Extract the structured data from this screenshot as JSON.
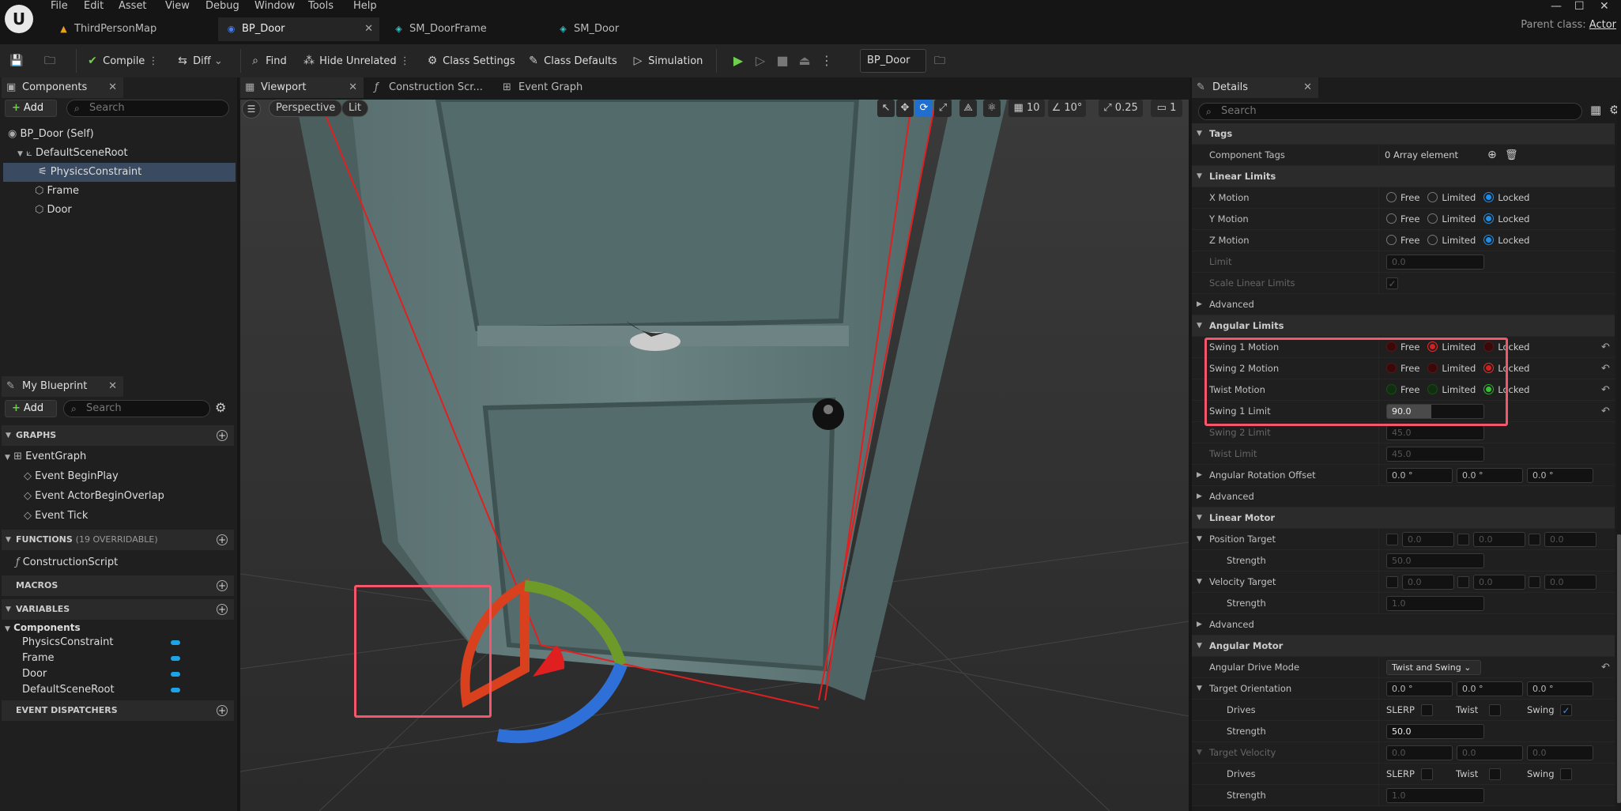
{
  "app": {
    "logo": "U",
    "menu": [
      "File",
      "Edit",
      "Asset",
      "View",
      "Debug",
      "Window",
      "Tools",
      "Help"
    ],
    "tabs": [
      {
        "label": "ThirdPersonMap",
        "icon": "map-icon"
      },
      {
        "label": "BP_Door",
        "icon": "blueprint-icon"
      },
      {
        "label": "SM_DoorFrame",
        "icon": "static-mesh-icon"
      },
      {
        "label": "SM_Door",
        "icon": "static-mesh-icon"
      }
    ],
    "parent_class_label": "Parent class:",
    "parent_class_value": "Actor"
  },
  "toolbar": {
    "compile": "Compile",
    "diff": "Diff",
    "find": "Find",
    "hide_unrelated": "Hide Unrelated",
    "class_settings": "Class Settings",
    "class_defaults": "Class Defaults",
    "simulation": "Simulation",
    "debug_object": "BP_Door"
  },
  "components": {
    "tab": "Components",
    "add": "Add",
    "search_placeholder": "Search",
    "tree": [
      "BP_Door (Self)",
      "DefaultSceneRoot",
      "PhysicsConstraint",
      "Frame",
      "Door"
    ]
  },
  "my_blueprint": {
    "tab": "My Blueprint",
    "add": "Add",
    "search_placeholder": "Search",
    "graphs_header": "GRAPHS",
    "event_graph": "EventGraph",
    "events": [
      "Event BeginPlay",
      "Event ActorBeginOverlap",
      "Event Tick"
    ],
    "functions_header": "FUNCTIONS",
    "functions_count": "(19 OVERRIDABLE)",
    "construction_script": "ConstructionScript",
    "macros_header": "MACROS",
    "variables_header": "VARIABLES",
    "components_group": "Components",
    "variables": [
      "PhysicsConstraint",
      "Frame",
      "Door",
      "DefaultSceneRoot"
    ],
    "event_dispatchers_header": "EVENT DISPATCHERS"
  },
  "editor_tabs": [
    "Viewport",
    "Construction Scr...",
    "Event Graph"
  ],
  "viewport": {
    "perspective": "Perspective",
    "lit": "Lit",
    "grid_snap": "10",
    "rot_snap": "10°",
    "scale_snap": "0.25",
    "camera_speed": "1"
  },
  "details": {
    "tab": "Details",
    "search_placeholder": "Search",
    "tags_header": "Tags",
    "component_tags": "Component Tags",
    "component_tags_value": "0 Array element",
    "linear_limits_header": "Linear Limits",
    "x_motion": "X Motion",
    "y_motion": "Y Motion",
    "z_motion": "Z Motion",
    "motion_options": [
      "Free",
      "Limited",
      "Locked"
    ],
    "limit": "Limit",
    "limit_value": "0.0",
    "scale_linear_limits": "Scale Linear Limits",
    "advanced": "Advanced",
    "angular_limits_header": "Angular Limits",
    "swing1_motion": "Swing 1 Motion",
    "swing2_motion": "Swing 2 Motion",
    "twist_motion": "Twist Motion",
    "swing1_limit": "Swing 1 Limit",
    "swing1_limit_value": "90.0",
    "swing2_limit": "Swing 2 Limit",
    "swing2_limit_value": "45.0",
    "twist_limit": "Twist Limit",
    "twist_limit_value": "45.0",
    "angular_rotation_offset": "Angular Rotation Offset",
    "angle_zero": "0.0 °",
    "linear_motor_header": "Linear Motor",
    "position_target": "Position Target",
    "zero": "0.0",
    "strength": "Strength",
    "position_strength": "50.0",
    "velocity_target": "Velocity Target",
    "velocity_strength": "1.0",
    "angular_motor_header": "Angular Motor",
    "angular_drive_mode": "Angular Drive Mode",
    "angular_drive_mode_value": "Twist and Swing",
    "target_orientation": "Target Orientation",
    "drives": "Drives",
    "slerp": "SLERP",
    "twist": "Twist",
    "swing": "Swing",
    "orientation_strength": "50.0",
    "target_velocity": "Target Velocity",
    "angular_velocity_strength": "1.0"
  },
  "colors": {
    "accent": "#1f8ee8",
    "highlight": "#f4566c",
    "selection": "#3a4b61"
  }
}
